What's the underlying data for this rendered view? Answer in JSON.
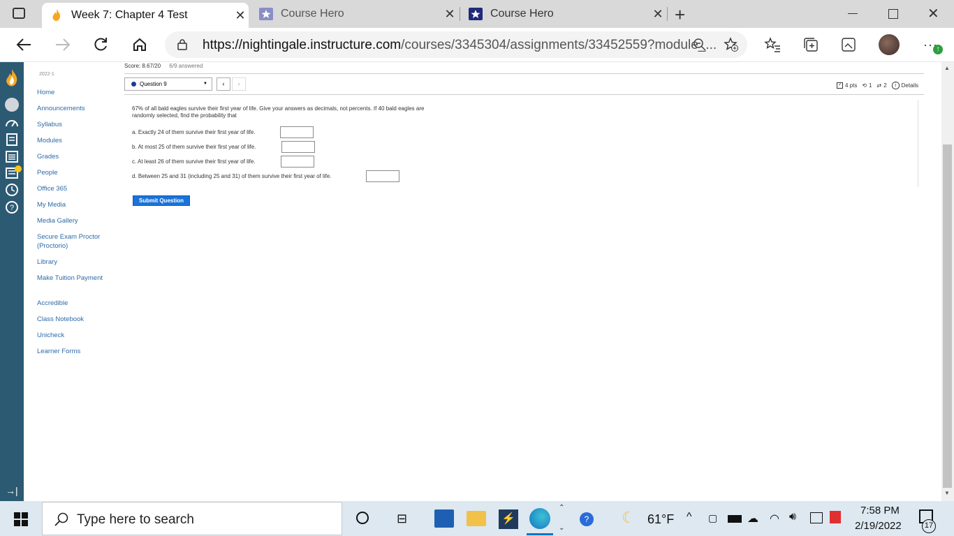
{
  "browser": {
    "tabs": [
      {
        "title": "Week 7: Chapter 4 Test",
        "active": true
      },
      {
        "title": "Course Hero",
        "active": false
      },
      {
        "title": "Course Hero",
        "active": false
      }
    ],
    "url_host": "https://nightingale.instructure.com",
    "url_path": "/courses/3345304/assignments/33452559?module_..."
  },
  "course_nav": {
    "term": "2022-1",
    "items": [
      "Home",
      "Announcements",
      "Syllabus",
      "Modules",
      "Grades",
      "People",
      "Office 365",
      "My Media",
      "Media Gallery",
      "Secure Exam Proctor (Proctorio)",
      "Library",
      "Make Tuition Payment",
      "Accredible",
      "Class Notebook",
      "Unicheck",
      "Learner Forms"
    ]
  },
  "quiz": {
    "score": "Score: 8.67/20",
    "answered": "6/9 answered",
    "question_select": "Question 9",
    "points": "4 pts",
    "retries": "1",
    "attempts": "2",
    "details": "Details",
    "prompt": "67% of all bald eagles survive their first year of life. Give your answers as decimals, not percents.  If 40 bald eagles are randomly selected, find the probability that",
    "parts": [
      "a. Exactly 24 of them survive their first year of life.",
      "b. At most 25 of them survive their first year of life.",
      "c. At least 26 of them survive their first year of life.",
      "d. Between 25 and 31 (including 25 and 31) of them survive their first year of life."
    ],
    "submit_label": "Submit Question"
  },
  "taskbar": {
    "search_placeholder": "Type here to search",
    "weather": "61°F",
    "time": "7:58 PM",
    "date": "2/19/2022",
    "notifications": "17"
  },
  "colors": {
    "rail": "#2d5a73",
    "link": "#2d6aa8",
    "submit": "#1a73d9"
  }
}
